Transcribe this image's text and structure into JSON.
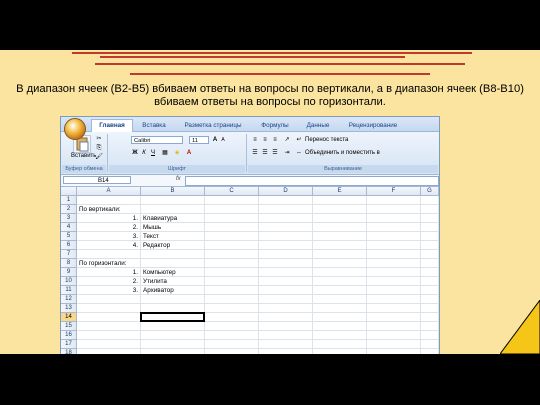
{
  "slide": {
    "text_line1": "В диапазон ячеек (B2-B5) вбиваем ответы на вопросы по вертикали, а в диапазон ячеек (B8-B10)",
    "text_line2": "вбиваем ответы на вопросы по горизонтали.",
    "accent_color": "#c0392b",
    "background_color": "#fbe49f"
  },
  "excel": {
    "tabs": [
      "Главная",
      "Вставка",
      "Разметка страницы",
      "Формулы",
      "Данные",
      "Рецензирование"
    ],
    "active_tab": "Главная",
    "ribbon": {
      "paste_label": "Вставить",
      "font_name": "Calibri",
      "font_size": "11",
      "wrap_text": "Перенос текста",
      "merge_center": "Объединить и поместить в",
      "group_clipboard": "Буфер обмена",
      "group_font": "Шрифт",
      "group_alignment": "Выравнивание"
    },
    "name_box": "B14",
    "fx_label": "fx",
    "columns": [
      "A",
      "B",
      "C",
      "D",
      "E",
      "F",
      "G"
    ],
    "rows": [
      {
        "num": "1",
        "a": "",
        "b": ""
      },
      {
        "num": "2",
        "a": "По вертикали:",
        "b": ""
      },
      {
        "num": "3",
        "a": "1.",
        "b": "Клавиатура"
      },
      {
        "num": "4",
        "a": "2.",
        "b": "Мышь"
      },
      {
        "num": "5",
        "a": "3.",
        "b": "Текст"
      },
      {
        "num": "6",
        "a": "4.",
        "b": "Редактор"
      },
      {
        "num": "7",
        "a": "",
        "b": ""
      },
      {
        "num": "8",
        "a": "По горизонтали:",
        "b": ""
      },
      {
        "num": "9",
        "a": "1.",
        "b": "Компьютер"
      },
      {
        "num": "10",
        "a": "2.",
        "b": "Утилита"
      },
      {
        "num": "11",
        "a": "3.",
        "b": "Архиватор"
      },
      {
        "num": "12",
        "a": "",
        "b": ""
      },
      {
        "num": "13",
        "a": "",
        "b": ""
      },
      {
        "num": "14",
        "a": "",
        "b": ""
      },
      {
        "num": "15",
        "a": "",
        "b": ""
      },
      {
        "num": "16",
        "a": "",
        "b": ""
      },
      {
        "num": "17",
        "a": "",
        "b": ""
      },
      {
        "num": "18",
        "a": "",
        "b": ""
      }
    ],
    "selected_row": "14",
    "selection_color": "#f9d78b"
  }
}
